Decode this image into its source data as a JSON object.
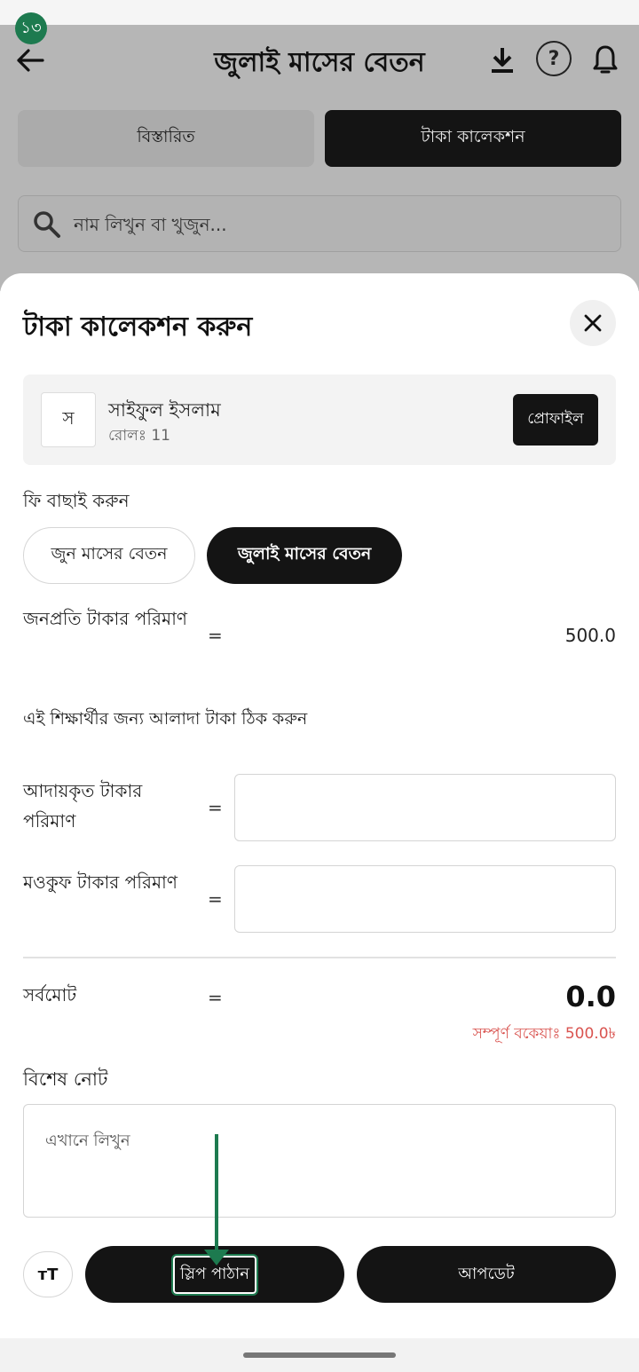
{
  "status": {
    "badge": "১৩"
  },
  "header": {
    "title": "জুলাই মাসের বেতন"
  },
  "tabs": [
    {
      "label": "বিস্তারিত",
      "active": false
    },
    {
      "label": "টাকা কালেকশন",
      "active": true
    }
  ],
  "search": {
    "placeholder": "নাম লিখুন বা খুজুন..."
  },
  "sheet": {
    "title": "টাকা কালেকশন করুন",
    "student": {
      "avatar_letter": "স",
      "name": "সাইফুল ইসলাম",
      "roll": "রোলঃ 11",
      "profile_label": "প্রোফাইল"
    },
    "fee_select_label": "ফি বাছাই করুন",
    "fee_options": [
      {
        "label": "জুন মাসের বেতন",
        "selected": false
      },
      {
        "label": "জুলাই মাসের বেতন",
        "selected": true
      }
    ],
    "per_amount": {
      "label": "জনপ্রতি টাকার পরিমাণ",
      "eq": "=",
      "value": "500.0"
    },
    "custom_note": "এই শিক্ষার্থীর জন্য আলাদা টাকা ঠিক করুন",
    "paid_amount": {
      "label": "আদায়কৃত টাকার পরিমাণ",
      "eq": "=",
      "value": ""
    },
    "waiver_amount": {
      "label": "মওকুফ টাকার পরিমাণ",
      "eq": "=",
      "value": ""
    },
    "total": {
      "label": "সর্বমোট",
      "eq": "=",
      "value": "0.0"
    },
    "due_text": "সম্পূর্ণ বকেয়াঃ 500.0৳",
    "special_note": {
      "label": "বিশেষ নোট",
      "placeholder": "এখানে লিখুন"
    },
    "actions": {
      "font_label": "ᴛT",
      "send_slip": "স্লিপ পাঠান",
      "update": "আপডেট"
    }
  },
  "colors": {
    "accent_green": "#1d7a4f",
    "dark": "#141414",
    "due_red": "#d9534f"
  }
}
